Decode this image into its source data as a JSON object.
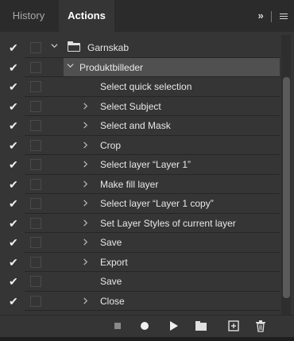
{
  "tabs": {
    "history": "History",
    "actions": "Actions",
    "overflow_label": "»"
  },
  "actions_list": [
    {
      "label": "Garnskab",
      "kind": "set",
      "expand": "open",
      "checked": true
    },
    {
      "label": "Produktbilleder",
      "kind": "action",
      "expand": "open",
      "checked": true
    },
    {
      "label": "Select quick selection",
      "kind": "step",
      "expand": "none",
      "checked": true
    },
    {
      "label": "Select Subject",
      "kind": "step",
      "expand": "closed",
      "checked": true
    },
    {
      "label": "Select and Mask",
      "kind": "step",
      "expand": "closed",
      "checked": true
    },
    {
      "label": "Crop",
      "kind": "step",
      "expand": "closed",
      "checked": true
    },
    {
      "label": "Select layer “Layer 1”",
      "kind": "step",
      "expand": "closed",
      "checked": true
    },
    {
      "label": "Make fill layer",
      "kind": "step",
      "expand": "closed",
      "checked": true
    },
    {
      "label": "Select layer “Layer 1 copy”",
      "kind": "step",
      "expand": "closed",
      "checked": true
    },
    {
      "label": "Set Layer Styles of current layer",
      "kind": "step",
      "expand": "closed",
      "checked": true
    },
    {
      "label": "Save",
      "kind": "step",
      "expand": "closed",
      "checked": true
    },
    {
      "label": "Export",
      "kind": "step",
      "expand": "closed",
      "checked": true
    },
    {
      "label": "Save",
      "kind": "step",
      "expand": "none",
      "checked": true
    },
    {
      "label": "Close",
      "kind": "step",
      "expand": "closed",
      "checked": true
    }
  ],
  "toolbar": {
    "icons": [
      "stop-icon",
      "record-icon",
      "play-icon",
      "new-set-folder-icon",
      "new-action-icon",
      "delete-icon"
    ]
  },
  "colors": {
    "panel_bg": "#353535",
    "tabbar_bg": "#2b2b2b",
    "selected_row_bg": "#505050",
    "text": "#e8e8e8"
  }
}
